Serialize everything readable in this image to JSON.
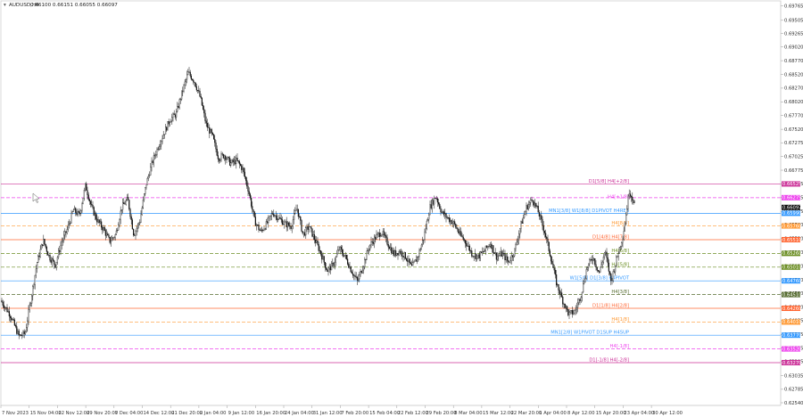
{
  "symbol_header": {
    "menu_glyph": "▾",
    "symbol": "AUDUSD,H4",
    "ohlc": "0.66100 0.66151 0.66055 0.66097"
  },
  "chart_data": {
    "type": "candlestick",
    "symbol": "AUDUSD",
    "timeframe": "H4",
    "ylim": [
      0.6254,
      0.6981
    ],
    "y_ticks": [
      "0.69765",
      "0.69505",
      "0.69265",
      "0.69020",
      "0.68770",
      "0.68520",
      "0.68270",
      "0.68020",
      "0.67770",
      "0.67520",
      "0.67275",
      "0.67025",
      "0.66775",
      "0.66525",
      "0.66275",
      "0.66025",
      "0.65780",
      "0.65530",
      "0.65280",
      "0.65030",
      "0.64780",
      "0.64530",
      "0.64280",
      "0.64035",
      "0.63785",
      "0.63535",
      "0.63295",
      "0.63035",
      "0.62785",
      "0.62540"
    ],
    "x_labels": [
      "7 Nov 2023",
      "15 Nov 04:00",
      "22 Nov 12:00",
      "29 Nov 20:00",
      "7 Dec 04:00",
      "14 Dec 12:00",
      "21 Dec 20:00",
      "2 Jan 04:00",
      "9 Jan 12:00",
      "16 Jan 20:00",
      "24 Jan 04:00",
      "31 Jan 12:00",
      "7 Feb 20:00",
      "15 Feb 04:00",
      "22 Feb 12:00",
      "29 Feb 20:00",
      "8 Mar 04:00",
      "15 Mar 12:00",
      "22 Mar 20:00",
      "1 Apr 04:00",
      "8 Apr 12:00",
      "15 Apr 20:00",
      "23 Apr 04:00",
      "30 Apr 12:00"
    ],
    "path_points": [
      [
        0,
        0.644
      ],
      [
        3,
        0.6415
      ],
      [
        6,
        0.6375
      ],
      [
        8,
        0.638
      ],
      [
        10,
        0.6445
      ],
      [
        12,
        0.651
      ],
      [
        14,
        0.655
      ],
      [
        16,
        0.652
      ],
      [
        18,
        0.6505
      ],
      [
        20,
        0.6545
      ],
      [
        22,
        0.657
      ],
      [
        24,
        0.6605
      ],
      [
        26,
        0.6595
      ],
      [
        28,
        0.665
      ],
      [
        30,
        0.661
      ],
      [
        32,
        0.6585
      ],
      [
        34,
        0.657
      ],
      [
        36,
        0.6548
      ],
      [
        38,
        0.656
      ],
      [
        40,
        0.661
      ],
      [
        42,
        0.6625
      ],
      [
        44,
        0.656
      ],
      [
        46,
        0.6585
      ],
      [
        48,
        0.665
      ],
      [
        50,
        0.669
      ],
      [
        52,
        0.672
      ],
      [
        54,
        0.6745
      ],
      [
        56,
        0.677
      ],
      [
        58,
        0.678
      ],
      [
        60,
        0.682
      ],
      [
        62,
        0.6855
      ],
      [
        64,
        0.684
      ],
      [
        66,
        0.681
      ],
      [
        68,
        0.676
      ],
      [
        70,
        0.674
      ],
      [
        72,
        0.67
      ],
      [
        74,
        0.6705
      ],
      [
        76,
        0.669
      ],
      [
        78,
        0.6695
      ],
      [
        80,
        0.668
      ],
      [
        82,
        0.664
      ],
      [
        84,
        0.6585
      ],
      [
        86,
        0.6565
      ],
      [
        88,
        0.658
      ],
      [
        90,
        0.66
      ],
      [
        92,
        0.659
      ],
      [
        94,
        0.658
      ],
      [
        96,
        0.6575
      ],
      [
        98,
        0.661
      ],
      [
        100,
        0.656
      ],
      [
        102,
        0.6575
      ],
      [
        104,
        0.655
      ],
      [
        106,
        0.6525
      ],
      [
        108,
        0.6495
      ],
      [
        110,
        0.6505
      ],
      [
        112,
        0.6535
      ],
      [
        114,
        0.652
      ],
      [
        116,
        0.6495
      ],
      [
        118,
        0.6475
      ],
      [
        120,
        0.6505
      ],
      [
        122,
        0.654
      ],
      [
        124,
        0.6555
      ],
      [
        126,
        0.6565
      ],
      [
        128,
        0.6545
      ],
      [
        130,
        0.6525
      ],
      [
        132,
        0.653
      ],
      [
        134,
        0.652
      ],
      [
        136,
        0.65
      ],
      [
        138,
        0.652
      ],
      [
        140,
        0.6555
      ],
      [
        142,
        0.661
      ],
      [
        144,
        0.663
      ],
      [
        146,
        0.66
      ],
      [
        148,
        0.659
      ],
      [
        150,
        0.658
      ],
      [
        152,
        0.656
      ],
      [
        154,
        0.6545
      ],
      [
        156,
        0.6525
      ],
      [
        158,
        0.652
      ],
      [
        160,
        0.653
      ],
      [
        162,
        0.6545
      ],
      [
        164,
        0.652
      ],
      [
        166,
        0.6525
      ],
      [
        168,
        0.651
      ],
      [
        170,
        0.653
      ],
      [
        172,
        0.6575
      ],
      [
        174,
        0.661
      ],
      [
        176,
        0.6625
      ],
      [
        178,
        0.66
      ],
      [
        180,
        0.6565
      ],
      [
        182,
        0.652
      ],
      [
        184,
        0.647
      ],
      [
        186,
        0.644
      ],
      [
        188,
        0.6415
      ],
      [
        190,
        0.642
      ],
      [
        192,
        0.645
      ],
      [
        194,
        0.65
      ],
      [
        196,
        0.652
      ],
      [
        198,
        0.649
      ],
      [
        200,
        0.653
      ],
      [
        202,
        0.6475
      ],
      [
        204,
        0.652
      ],
      [
        206,
        0.656
      ],
      [
        208,
        0.664
      ],
      [
        210,
        0.6615
      ]
    ],
    "levels": [
      {
        "label": "D1[5/8] H4[+2/8]",
        "price": 0.66525,
        "color": "#cc3399",
        "dash": "solid",
        "tag": "0.66525"
      },
      {
        "label": "",
        "price": 0.66275,
        "color": "#ee44ee",
        "dash": "dashed",
        "tag": "0.66275",
        "tag_color": "#ee44ee"
      },
      {
        "label": "H4[+1/8]",
        "price": 0.6624,
        "color": "#ee44ee",
        "dash": "none",
        "tag": ""
      },
      {
        "label": "",
        "price": 0.66097,
        "color": "#222222",
        "dash": "none",
        "tag": "0.66097",
        "tag_color": "#111111"
      },
      {
        "label": "MN1[3/8] W1[8/8] D1PIVOT H4RES",
        "price": 0.6599,
        "color": "#3399ff",
        "dash": "solid",
        "tag": "0.65990"
      },
      {
        "label": "H4[8/8]",
        "price": 0.6576,
        "color": "#ff9933",
        "dash": "dashed",
        "tag": "0.65760"
      },
      {
        "label": "D1[4/8] H4[7/8]",
        "price": 0.6551,
        "color": "#ff6633",
        "dash": "solid",
        "tag": "0.65510"
      },
      {
        "label": "H4[6/8]",
        "price": 0.6526,
        "color": "#6b8e23",
        "dash": "dashed",
        "tag": "0.65260"
      },
      {
        "label": "H4[5/8]",
        "price": 0.6501,
        "color": "#6b8e23",
        "dash": "dashed",
        "tag": "0.65010",
        "tag_color": "#6b8e23"
      },
      {
        "label": "W1[5/8] D1[3/8] H4PIVOT",
        "price": 0.6476,
        "color": "#3399ff",
        "dash": "solid",
        "tag": "0.64760"
      },
      {
        "label": "H4[3/8]",
        "price": 0.6451,
        "color": "#556b2f",
        "dash": "dashed",
        "tag": "0.64510"
      },
      {
        "label": "D1[1/8] H4[2/8]",
        "price": 0.6426,
        "color": "#ff6633",
        "dash": "solid",
        "tag": "0.64260"
      },
      {
        "label": "H4[1/8]",
        "price": 0.6401,
        "color": "#ff9933",
        "dash": "dashed",
        "tag": "0.64010"
      },
      {
        "label": "MN1[2/8] W1PIVOT D1SUP H4SUP",
        "price": 0.6377,
        "color": "#3399ff",
        "dash": "solid",
        "tag": "0.63770"
      },
      {
        "label": "H4[-1/8]",
        "price": 0.6352,
        "color": "#ee44ee",
        "dash": "dashed",
        "tag": "0.63520"
      },
      {
        "label": "D1[-1/8] H4[-2/8]",
        "price": 0.6327,
        "color": "#cc3399",
        "dash": "solid",
        "tag": "0.63270"
      }
    ]
  }
}
